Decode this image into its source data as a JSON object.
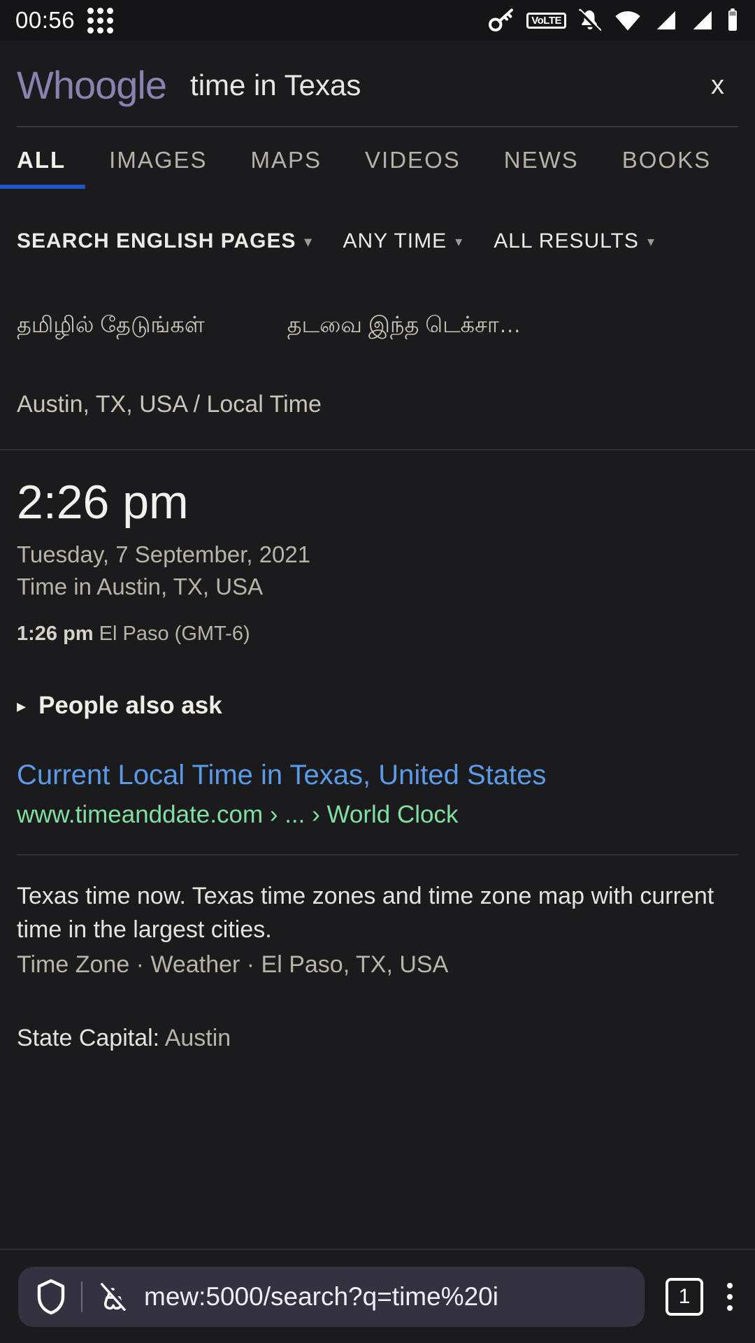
{
  "statusbar": {
    "time": "00:56",
    "icons": [
      "app-grid-icon",
      "vpn-key-icon",
      "volte-icon",
      "notifications-muted-icon",
      "wifi-icon",
      "signal-sim1-icon",
      "signal-sim2-icon",
      "battery-icon"
    ],
    "volte_label": "VoLTE"
  },
  "header": {
    "logo": "Whoogle",
    "query": "time in Texas",
    "clear_label": "x"
  },
  "tabs": [
    {
      "label": "ALL",
      "active": true
    },
    {
      "label": "IMAGES",
      "active": false
    },
    {
      "label": "MAPS",
      "active": false
    },
    {
      "label": "VIDEOS",
      "active": false
    },
    {
      "label": "NEWS",
      "active": false
    },
    {
      "label": "BOOKS",
      "active": false
    }
  ],
  "filters": [
    {
      "label": "SEARCH ENGLISH PAGES",
      "bold": true,
      "caret": "▾"
    },
    {
      "label": "ANY TIME",
      "bold": false,
      "caret": "▾"
    },
    {
      "label": "ALL RESULTS",
      "bold": false,
      "caret": "▾"
    }
  ],
  "language_suggestions": [
    "தமிழில் தேடுங்கள்",
    "தடவை இந்த டெக்சா…"
  ],
  "time_card": {
    "title": "Austin, TX, USA / Local Time",
    "time": "2:26 pm",
    "date": "Tuesday, 7 September, 2021",
    "location": "Time in Austin, TX, USA",
    "other_zone_time": "1:26 pm",
    "other_zone_label": "El Paso (GMT-6)"
  },
  "people_also_ask": {
    "marker": "▸",
    "label": "People also ask"
  },
  "result": {
    "title": "Current Local Time in Texas, United States",
    "url": "www.timeanddate.com › ... › World Clock",
    "description": "Texas time now. Texas time zones and time zone map with current time in the largest cities.",
    "sublinks": "Time Zone · Weather · El Paso, TX, USA",
    "extra_label": "State Capital:",
    "extra_value": "Austin"
  },
  "browser_bar": {
    "url": "mew:5000/search?q=time%20i",
    "tab_count": "1",
    "shield_icon": "shield-icon",
    "incognito_icon": "incognito-mask-icon",
    "menu_icon": "kebab-menu-icon"
  },
  "colors": {
    "page_bg": "#1b1b1d",
    "logo": "#8a82b0",
    "tab_active_underline": "#1a56c4",
    "link": "#5b9ae6",
    "url_green": "#81e0a1",
    "urlbar_bg": "#343140"
  }
}
